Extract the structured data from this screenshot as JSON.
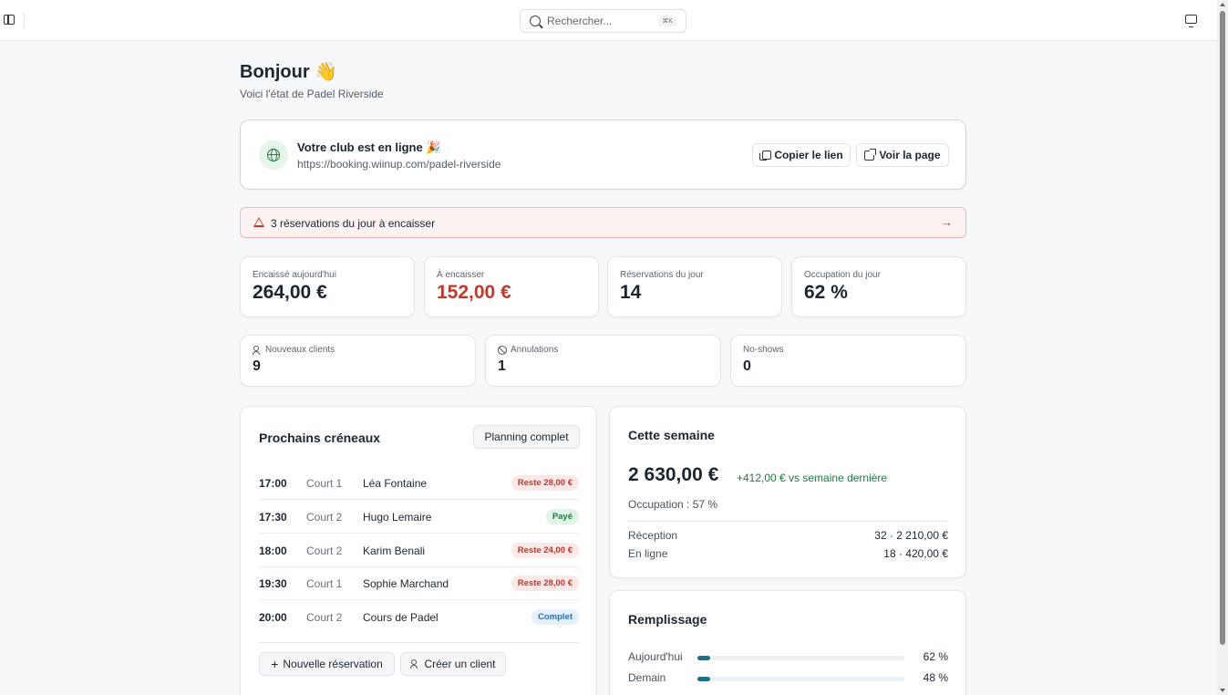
{
  "topbar": {
    "search_placeholder": "Rechercher...",
    "search_shortcut": "⌘K"
  },
  "greeting": {
    "title": "Bonjour 👋",
    "subtitle": "Voici l'état de Padel Riverside"
  },
  "online": {
    "title": "Votre club est en ligne 🎉",
    "url": "https://booking.wiinup.com/padel-riverside",
    "copy_label": "Copier le lien",
    "view_label": "Voir la page"
  },
  "alert": {
    "text": "3 réservations du jour à encaisser",
    "arrow": "→"
  },
  "stats": [
    {
      "label": "Encaissé aujourd'hui",
      "value": "264,00 €"
    },
    {
      "label": "À encaisser",
      "value": "152,00 €"
    },
    {
      "label": "Réservations du jour",
      "value": "14"
    },
    {
      "label": "Occupation du jour",
      "value": "62 %"
    }
  ],
  "stats2": [
    {
      "label": "Nouveaux clients",
      "value": "9"
    },
    {
      "label": "Annulations",
      "value": "1"
    },
    {
      "label": "No-shows",
      "value": "0"
    }
  ],
  "slots": {
    "title": "Prochains créneaux",
    "planning_label": "Planning complet",
    "rows": [
      {
        "time": "17:00",
        "court": "Court 1",
        "name": "Léa Fontaine",
        "badge": "Reste 28,00 €",
        "badge_type": "red"
      },
      {
        "time": "17:30",
        "court": "Court 2",
        "name": "Hugo Lemaire",
        "badge": "Payé",
        "badge_type": "green"
      },
      {
        "time": "18:00",
        "court": "Court 2",
        "name": "Karim Benali",
        "badge": "Reste 24,00 €",
        "badge_type": "red"
      },
      {
        "time": "19:30",
        "court": "Court 1",
        "name": "Sophie Marchand",
        "badge": "Reste 28,00 €",
        "badge_type": "red"
      },
      {
        "time": "20:00",
        "court": "Court 2",
        "name": "Cours de Padel",
        "badge": "Complet",
        "badge_type": "blue"
      }
    ],
    "new_booking_label": "Nouvelle réservation",
    "new_client_label": "Créer un client"
  },
  "week": {
    "title": "Cette semaine",
    "amount": "2 630,00 €",
    "delta": "+412,00 € vs semaine dernière",
    "occupation": "Occupation : 57 %",
    "reception_label": "Réception",
    "reception_value": "32 · 2 210,00 €",
    "online_label": "En ligne",
    "online_value": "18 · 420,00 €"
  },
  "fill": {
    "title": "Remplissage",
    "rows": [
      {
        "label": "Aujourd'hui",
        "pct_text": "62 %",
        "level": 0.06
      },
      {
        "label": "Demain",
        "pct_text": "48 %",
        "level": 0.06
      }
    ]
  },
  "colors": {
    "accent": "#1f6f8b",
    "danger": "#c0392b",
    "success": "#1f7a3e"
  }
}
